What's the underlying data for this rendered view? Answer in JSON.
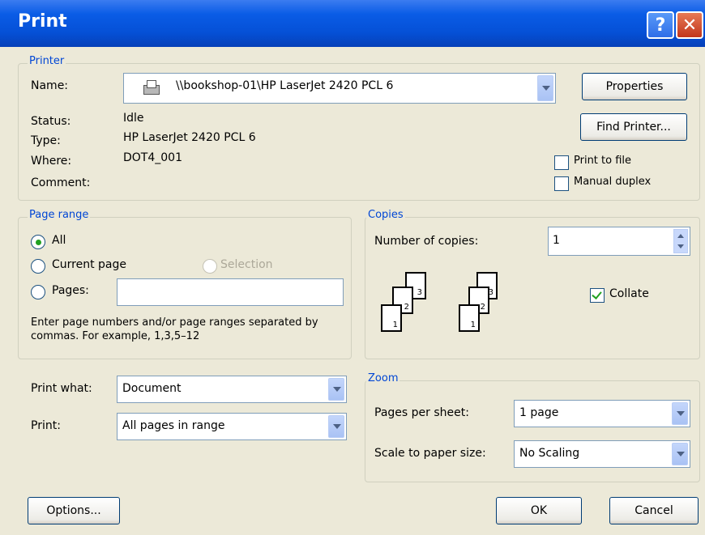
{
  "window": {
    "title": "Print",
    "help_glyph": "?",
    "close_glyph": "✕"
  },
  "printer": {
    "group_label": "Printer",
    "name_label": "Name:",
    "name_value": "\\\\bookshop-01\\HP LaserJet 2420 PCL 6",
    "status_label": "Status:",
    "status_value": "Idle",
    "type_label": "Type:",
    "type_value": "HP LaserJet 2420 PCL 6",
    "where_label": "Where:",
    "where_value": "DOT4_001",
    "comment_label": "Comment:",
    "comment_value": "",
    "properties_button": "Properties",
    "find_printer_button": "Find Printer...",
    "print_to_file_label": "Print to file",
    "print_to_file_checked": false,
    "manual_duplex_label": "Manual duplex",
    "manual_duplex_checked": false
  },
  "page_range": {
    "group_label": "Page range",
    "all_label": "All",
    "current_page_label": "Current page",
    "selection_label": "Selection",
    "pages_label": "Pages:",
    "pages_value": "",
    "selected": "all",
    "hint": "Enter page numbers and/or page ranges separated by commas.  For example, 1,3,5–12"
  },
  "copies": {
    "group_label": "Copies",
    "number_label": "Number of copies:",
    "number_value": "1",
    "collate_label": "Collate",
    "collate_checked": true,
    "stack_labels": [
      "3",
      "2",
      "1"
    ]
  },
  "print_what": {
    "label": "Print what:",
    "value": "Document"
  },
  "print": {
    "label": "Print:",
    "value": "All pages in range"
  },
  "zoom": {
    "group_label": "Zoom",
    "pages_per_sheet_label": "Pages per sheet:",
    "pages_per_sheet_value": "1 page",
    "scale_label": "Scale to paper size:",
    "scale_value": "No Scaling"
  },
  "footer": {
    "options_button": "Options...",
    "ok_button": "OK",
    "cancel_button": "Cancel"
  },
  "colors": {
    "titlebar": "#0550d6",
    "dialog_bg": "#ece9d8",
    "group_label": "#0046d5",
    "radio_dot": "#21a121"
  }
}
